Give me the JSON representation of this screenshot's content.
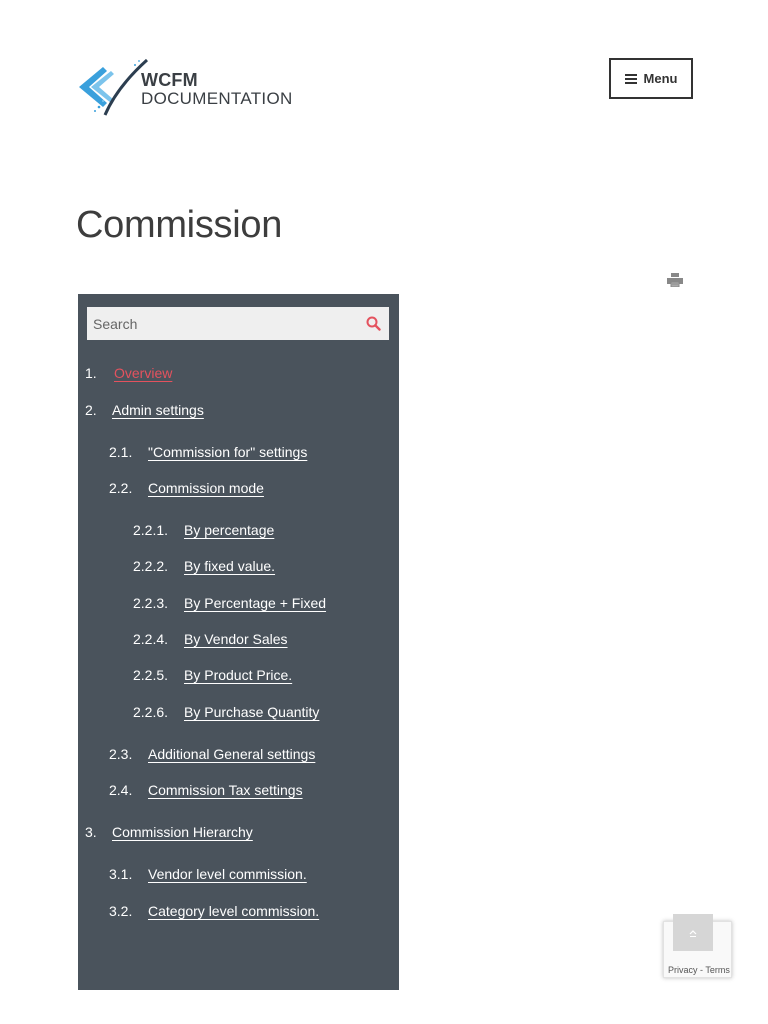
{
  "header": {
    "logo_line1": "WCFM",
    "logo_line2": "DOCUMENTATION",
    "menu_label": "Menu"
  },
  "page": {
    "title": "Commission"
  },
  "toc": {
    "search_placeholder": "Search",
    "items": [
      {
        "num": "1.",
        "label": "Overview",
        "active": true
      },
      {
        "num": "2.",
        "label": "Admin settings"
      },
      {
        "num": "2.1.",
        "label": "\"Commission for\" settings"
      },
      {
        "num": "2.2.",
        "label": "Commission mode"
      },
      {
        "num": "2.2.1.",
        "label": "By percentage"
      },
      {
        "num": "2.2.2.",
        "label": "By fixed value."
      },
      {
        "num": "2.2.3.",
        "label": "By Percentage + Fixed"
      },
      {
        "num": "2.2.4.",
        "label": "By Vendor Sales"
      },
      {
        "num": "2.2.5.",
        "label": "By Product Price."
      },
      {
        "num": "2.2.6.",
        "label": "By Purchase Quantity"
      },
      {
        "num": "2.3.",
        "label": "Additional General settings"
      },
      {
        "num": "2.4.",
        "label": "Commission Tax settings"
      },
      {
        "num": "3.",
        "label": "Commission Hierarchy"
      },
      {
        "num": "3.1.",
        "label": "Vendor level commission."
      },
      {
        "num": "3.2.",
        "label": "Category level commission."
      }
    ]
  },
  "recaptcha": {
    "footer": "Privacy - Terms"
  },
  "colors": {
    "toc_background": "#4a535c",
    "active_link": "#e4525e",
    "logo_blue": "#3aa0dc"
  }
}
